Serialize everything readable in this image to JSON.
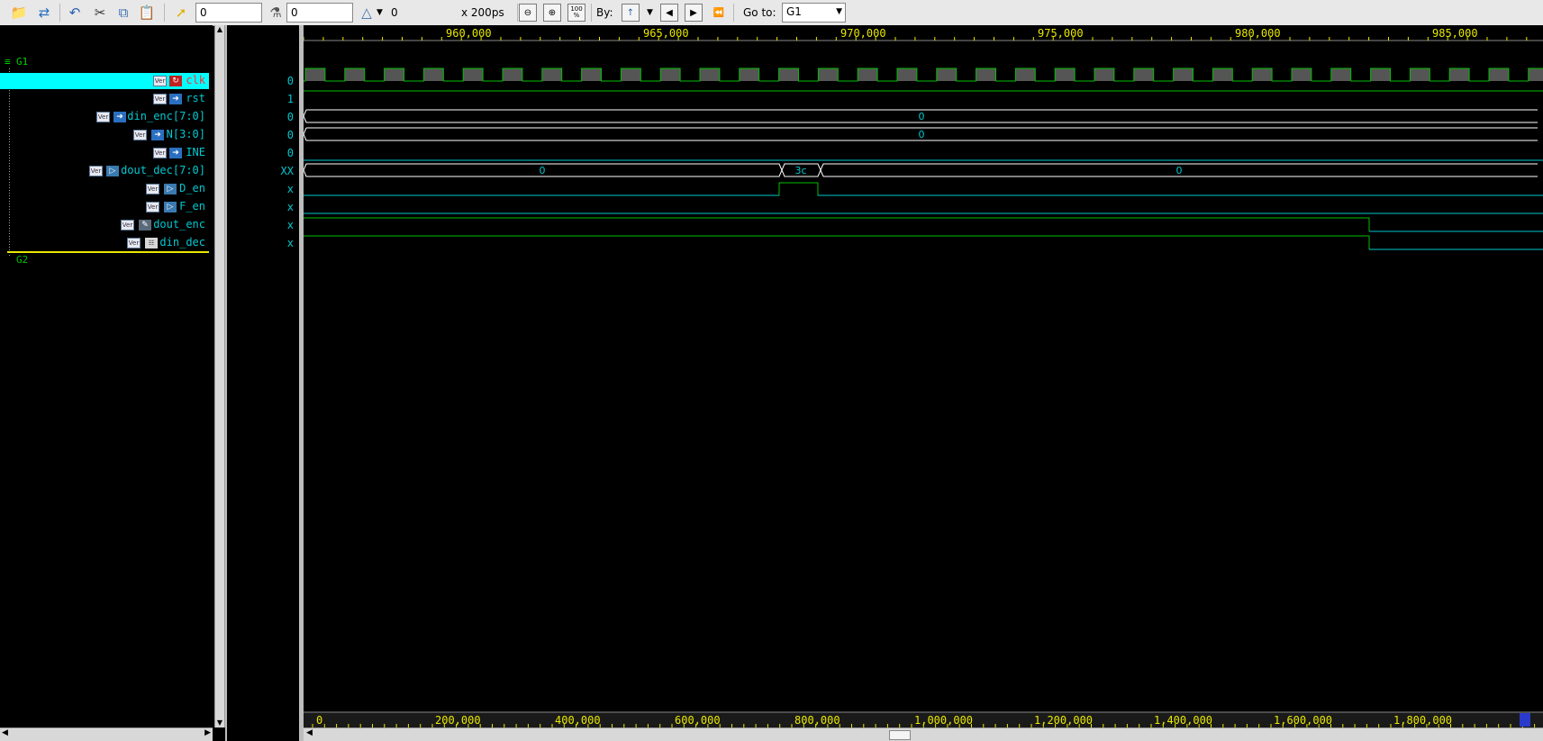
{
  "toolbar": {
    "cursor_field": "0",
    "marker_field": "0",
    "delta_value": "0",
    "time_scale": "x 200ps",
    "zoom_fit_label": "100\n%",
    "by_label": "By:",
    "goto_label": "Go to:",
    "goto_value": "G1"
  },
  "groups": [
    {
      "name": "G1"
    },
    {
      "name": "G2"
    }
  ],
  "signals": [
    {
      "name": "clk",
      "value": "0",
      "type": "input",
      "selected": true,
      "wave": "clock"
    },
    {
      "name": "rst",
      "value": "1",
      "type": "input",
      "wave": "high"
    },
    {
      "name": "din_enc[7:0]",
      "value": "0",
      "type": "input",
      "wave": "bus",
      "bus_labels": [
        "0"
      ]
    },
    {
      "name": "N[3:0]",
      "value": "0",
      "type": "input",
      "wave": "bus",
      "bus_labels": [
        "0"
      ]
    },
    {
      "name": "INE",
      "value": "0",
      "type": "input",
      "wave": "low"
    },
    {
      "name": "dout_dec[7:0]",
      "value": "XX",
      "type": "output",
      "wave": "bus3",
      "bus_labels": [
        "0",
        "3c",
        "0"
      ]
    },
    {
      "name": "D_en",
      "value": "x",
      "type": "output",
      "wave": "pulse"
    },
    {
      "name": "F_en",
      "value": "x",
      "type": "output",
      "wave": "low"
    },
    {
      "name": "dout_enc",
      "value": "x",
      "type": "register",
      "wave": "fall"
    },
    {
      "name": "din_dec",
      "value": "x",
      "type": "internal",
      "wave": "fall"
    }
  ],
  "top_ruler": {
    "ticks": [
      "960,000",
      "965,000",
      "970,000",
      "975,000",
      "980,000",
      "985,000"
    ]
  },
  "bottom_ruler": {
    "ticks": [
      "0",
      "200,000",
      "400,000",
      "600,000",
      "800,000",
      "1,000,000",
      "1,200,000",
      "1,400,000",
      "1,600,000",
      "1,800,000"
    ]
  },
  "colors": {
    "accent_cyan": "#00ffff",
    "wave_green": "#00c000",
    "wave_cyan": "#00c8d0",
    "ruler_yellow": "#e8e800",
    "bus_white": "#ffffff"
  },
  "icons": [
    "open-folder-icon",
    "reload-icon",
    "undo-icon",
    "cut-icon",
    "copy-icon",
    "paste-icon",
    "pointer-icon",
    "marker-icon",
    "delta-icon",
    "zoom-out-icon",
    "zoom-in-icon",
    "zoom-fit-icon",
    "edge-select-icon",
    "prev-edge-icon",
    "next-edge-icon",
    "back-icon"
  ]
}
